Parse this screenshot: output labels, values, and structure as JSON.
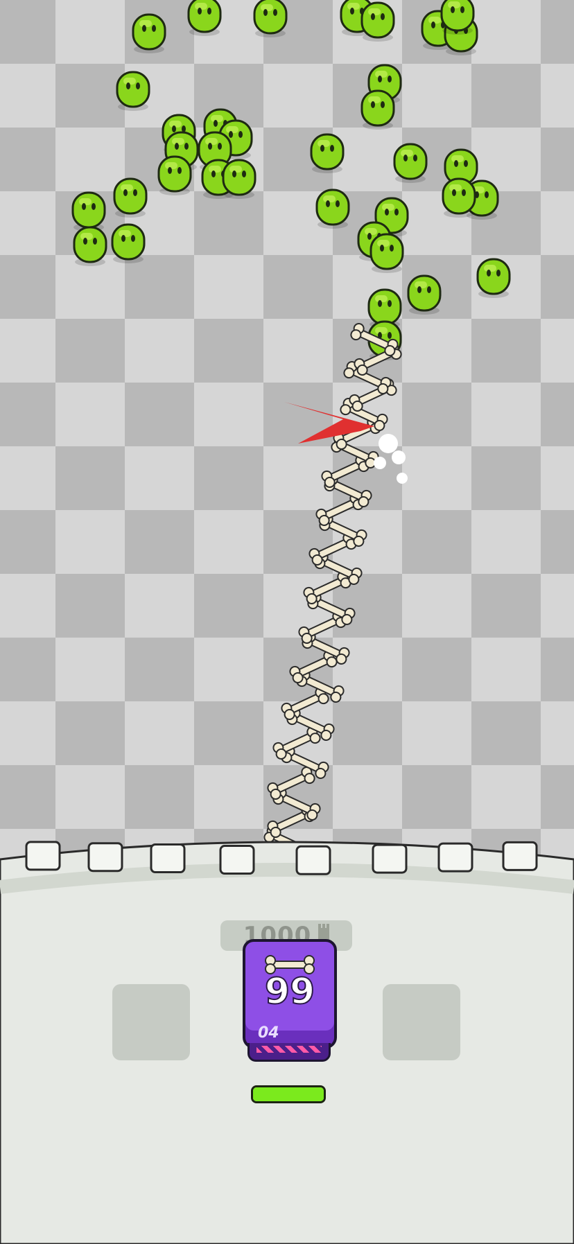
{
  "game": {
    "board_colors": {
      "light": "#d6d6d6",
      "dark": "#b8b8b8"
    },
    "enemy_color": "#8ad61c",
    "bone_color": "#f2ead2",
    "castle_color": "#e6e9e4",
    "tower_hp_label": "1000",
    "dice": {
      "value": "99",
      "tag": "04",
      "body_color": "#8e4fe6",
      "icon": "bone-icon"
    },
    "health_bar": {
      "fill_fraction": 1.0,
      "color": "#7bea1d"
    }
  }
}
